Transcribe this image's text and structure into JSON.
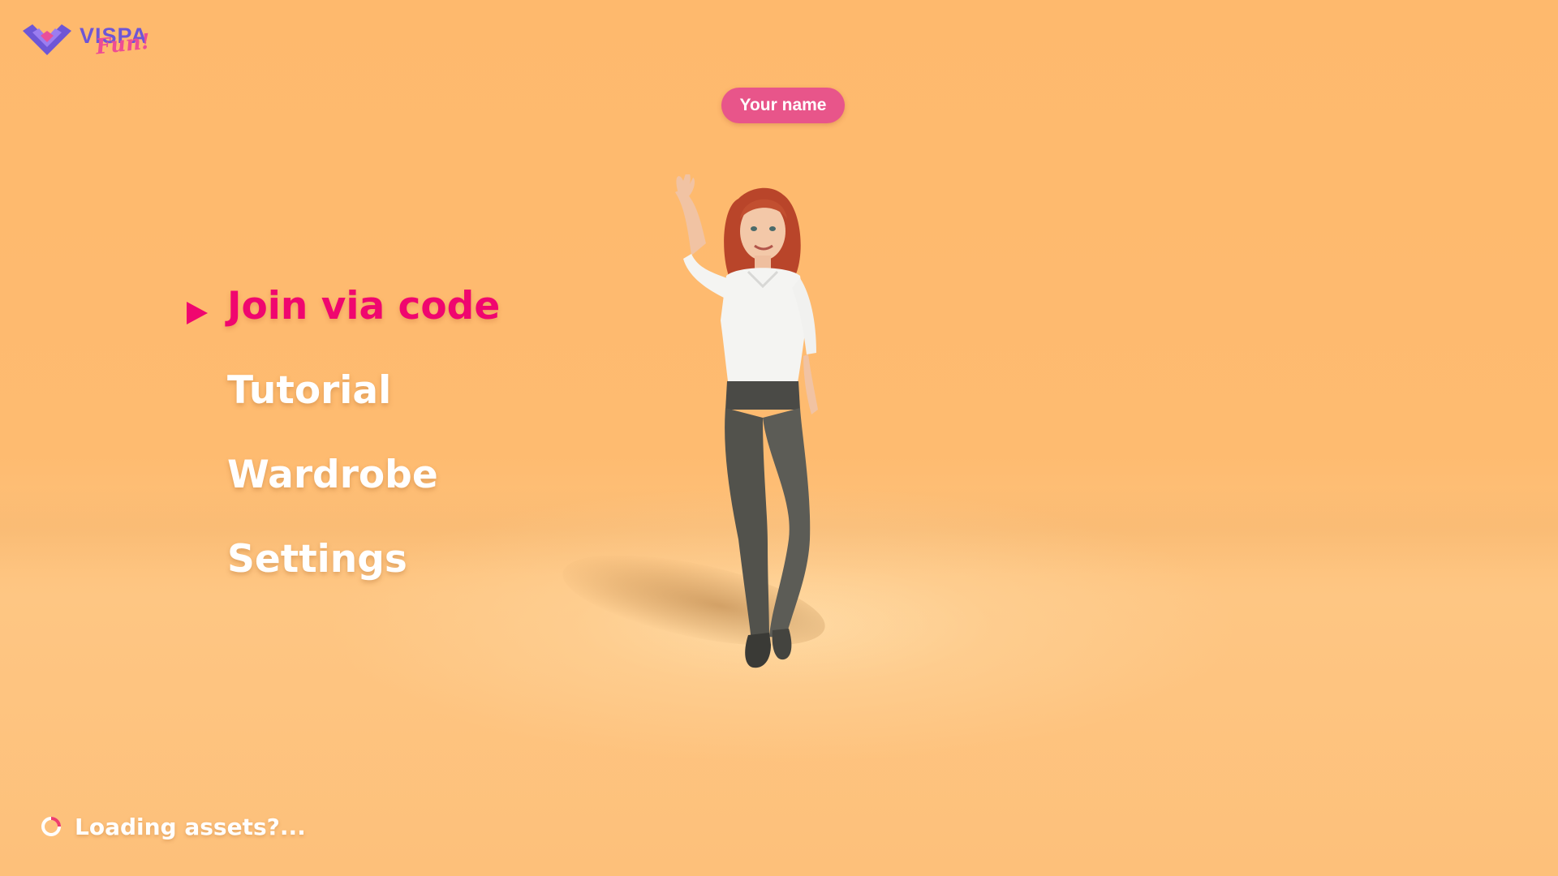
{
  "app": {
    "logo_text": "VISPA",
    "logo_script": "Fun!"
  },
  "player": {
    "name_tag": "Your name"
  },
  "menu": {
    "items": [
      {
        "label": "Join via code",
        "selected": true
      },
      {
        "label": "Tutorial",
        "selected": false
      },
      {
        "label": "Wardrobe",
        "selected": false
      },
      {
        "label": "Settings",
        "selected": false
      }
    ],
    "selection_marker_icon": "play-triangle-icon"
  },
  "status": {
    "loading_text": "Loading assets?...",
    "spinner_icon": "loading-spinner-icon"
  },
  "colors": {
    "background": "#feb96d",
    "menu_selected": "#f0066f",
    "menu_default": "#ffffff",
    "name_tag": "#e8558a",
    "logo_primary": "#6e56d6",
    "logo_accent": "#ee4c94"
  }
}
